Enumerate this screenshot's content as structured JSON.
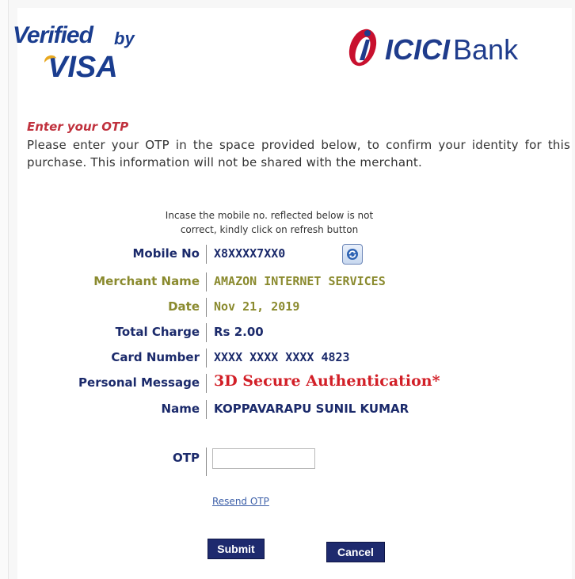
{
  "logos": {
    "vbv_verified": "Verified",
    "vbv_by": "by",
    "vbv_visa": "VISA",
    "bank_name_icici": "ICICI",
    "bank_name_bank": "Bank"
  },
  "colors": {
    "heading": "#c0313d",
    "label_navy": "#1b2a6b",
    "label_olive": "#8a8a2e",
    "personal_message": "#d21f27",
    "button_bg": "#1e2a6e"
  },
  "page": {
    "heading": "Enter your OTP",
    "intro": "Please enter your OTP in the space provided below, to confirm your identity for this purchase. This information will not be shared with the merchant.",
    "note_line1": "Incase the mobile no. reflected below is not",
    "note_line2": "correct, kindly click on refresh button"
  },
  "details": [
    {
      "label": "Mobile No",
      "value": "X8XXXX7XX0"
    },
    {
      "label": "Merchant Name",
      "value": "AMAZON INTERNET SERVICES"
    },
    {
      "label": "Date",
      "value": "Nov 21, 2019"
    },
    {
      "label": "Total Charge",
      "value": "Rs 2.00"
    },
    {
      "label": "Card Number",
      "value": "XXXX XXXX XXXX 4823"
    },
    {
      "label": "Personal Message",
      "value": "3D Secure Authentication*"
    },
    {
      "label": "Name",
      "value": "KOPPAVARAPU SUNIL KUMAR"
    }
  ],
  "otp": {
    "label": "OTP",
    "value": "",
    "resend_label": "Resend OTP"
  },
  "buttons": {
    "submit": "Submit",
    "cancel": "Cancel"
  },
  "icons": {
    "refresh": "refresh-icon"
  }
}
